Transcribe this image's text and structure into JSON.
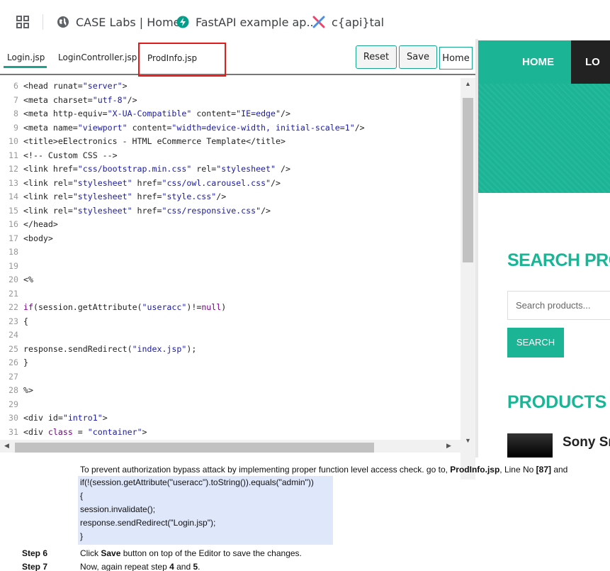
{
  "bookmarks": {
    "items": [
      {
        "label": "CASE Labs | Home"
      },
      {
        "label": "FastAPI example ap..."
      },
      {
        "label": "c{api}tal"
      }
    ]
  },
  "editor": {
    "tabs": [
      "Login.jsp",
      "LoginController.jsp",
      "ProdInfo.jsp"
    ],
    "active_tab": "Login.jsp",
    "highlighted_tab": "ProdInfo.jsp",
    "buttons": {
      "reset": "Reset",
      "save": "Save",
      "home": "Home"
    },
    "lines": [
      {
        "n": "6",
        "tokens": [
          [
            "t",
            "<head runat="
          ],
          [
            "s",
            "\"server\""
          ],
          [
            "t",
            ">"
          ]
        ]
      },
      {
        "n": "7",
        "tokens": [
          [
            "t",
            "<meta charset="
          ],
          [
            "s",
            "\"utf-8\""
          ],
          [
            "t",
            "/>"
          ]
        ]
      },
      {
        "n": "8",
        "tokens": [
          [
            "t",
            "<meta http-equiv="
          ],
          [
            "s",
            "\"X-UA-Compatible\""
          ],
          [
            "t",
            " content="
          ],
          [
            "s",
            "\"IE=edge\""
          ],
          [
            "t",
            "/>"
          ]
        ]
      },
      {
        "n": "9",
        "tokens": [
          [
            "t",
            "<meta name="
          ],
          [
            "s",
            "\"viewport\""
          ],
          [
            "t",
            " content="
          ],
          [
            "s",
            "\"width=device-width, initial-scale=1\""
          ],
          [
            "t",
            "/>"
          ]
        ]
      },
      {
        "n": "10",
        "tokens": [
          [
            "t",
            "<title>eElectronics - HTML eCommerce Template</title>"
          ]
        ]
      },
      {
        "n": "11",
        "tokens": [
          [
            "t",
            "<!-- Custom CSS -->"
          ]
        ]
      },
      {
        "n": "12",
        "tokens": [
          [
            "t",
            "<link href="
          ],
          [
            "s",
            "\"css/bootstrap.min.css\""
          ],
          [
            "t",
            " rel="
          ],
          [
            "s",
            "\"stylesheet\""
          ],
          [
            "t",
            " />"
          ]
        ]
      },
      {
        "n": "13",
        "tokens": [
          [
            "t",
            "<link rel="
          ],
          [
            "s",
            "\"stylesheet\""
          ],
          [
            "t",
            " href="
          ],
          [
            "s",
            "\"css/owl.carousel.css\""
          ],
          [
            "t",
            "/>"
          ]
        ]
      },
      {
        "n": "14",
        "tokens": [
          [
            "t",
            "<link rel="
          ],
          [
            "s",
            "\"stylesheet\""
          ],
          [
            "t",
            " href="
          ],
          [
            "s",
            "\"style.css\""
          ],
          [
            "t",
            "/>"
          ]
        ]
      },
      {
        "n": "15",
        "tokens": [
          [
            "t",
            "<link rel="
          ],
          [
            "s",
            "\"stylesheet\""
          ],
          [
            "t",
            " href="
          ],
          [
            "s",
            "\"css/responsive.css\""
          ],
          [
            "t",
            "/>"
          ]
        ]
      },
      {
        "n": "16",
        "tokens": [
          [
            "t",
            "</head>"
          ]
        ]
      },
      {
        "n": "17",
        "tokens": [
          [
            "t",
            "<body>"
          ]
        ]
      },
      {
        "n": "18",
        "tokens": []
      },
      {
        "n": "19",
        "tokens": []
      },
      {
        "n": "20",
        "tokens": [
          [
            "t",
            "<%"
          ]
        ]
      },
      {
        "n": "21",
        "tokens": []
      },
      {
        "n": "22",
        "tokens": [
          [
            "k",
            "if"
          ],
          [
            "t",
            "(session.getAttribute("
          ],
          [
            "s",
            "\"useracc\""
          ],
          [
            "t",
            ")!="
          ],
          [
            "k",
            "null"
          ],
          [
            "t",
            ")"
          ]
        ]
      },
      {
        "n": "23",
        "tokens": [
          [
            "t",
            "{"
          ]
        ]
      },
      {
        "n": "24",
        "tokens": []
      },
      {
        "n": "25",
        "tokens": [
          [
            "t",
            "response.sendRedirect("
          ],
          [
            "s",
            "\"index.jsp\""
          ],
          [
            "t",
            ");"
          ]
        ]
      },
      {
        "n": "26",
        "tokens": [
          [
            "t",
            "}"
          ]
        ]
      },
      {
        "n": "27",
        "tokens": []
      },
      {
        "n": "28",
        "tokens": [
          [
            "t",
            "%>"
          ]
        ]
      },
      {
        "n": "29",
        "tokens": []
      },
      {
        "n": "30",
        "tokens": [
          [
            "t",
            "<div id="
          ],
          [
            "s",
            "\"intro1\""
          ],
          [
            "t",
            ">"
          ]
        ]
      },
      {
        "n": "31",
        "tokens": [
          [
            "t",
            "<div "
          ],
          [
            "k",
            "class"
          ],
          [
            "t",
            " = "
          ],
          [
            "s",
            "\"container\""
          ],
          [
            "t",
            ">"
          ]
        ]
      }
    ]
  },
  "preview": {
    "nav_home": "HOME",
    "nav_login": "LO",
    "search_title": "SEARCH PROD",
    "search_placeholder": "Search products...",
    "search_button": "SEARCH",
    "products_title": "PRODUCTS",
    "product_name": "Sony Sm"
  },
  "instructions": {
    "intro_pre": "To prevent authorization bypass attack by implementing proper function level access check. go to, ",
    "intro_file": "ProdInfo.jsp",
    "intro_mid": ", Line No ",
    "intro_line": "[87]",
    "intro_post": " and",
    "code_lines": [
      "if(!(session.getAttribute(\"useracc\").toString()).equals(\"admin\"))",
      "{",
      "session.invalidate();",
      "response.sendRedirect(\"Login.jsp\");",
      "}"
    ],
    "step6_label": "Step 6",
    "step6_pre": "Click ",
    "step6_bold": "Save",
    "step6_post": " button on top of the Editor to save the changes.",
    "step7_label": "Step 7",
    "step7_pre": "Now, again repeat step ",
    "step7_b1": "4",
    "step7_mid": " and ",
    "step7_b2": "5",
    "step7_post": "."
  },
  "colors": {
    "accent": "#1bb596",
    "highlight_border": "#e11b1b",
    "code_bg": "#dfe7fa"
  }
}
